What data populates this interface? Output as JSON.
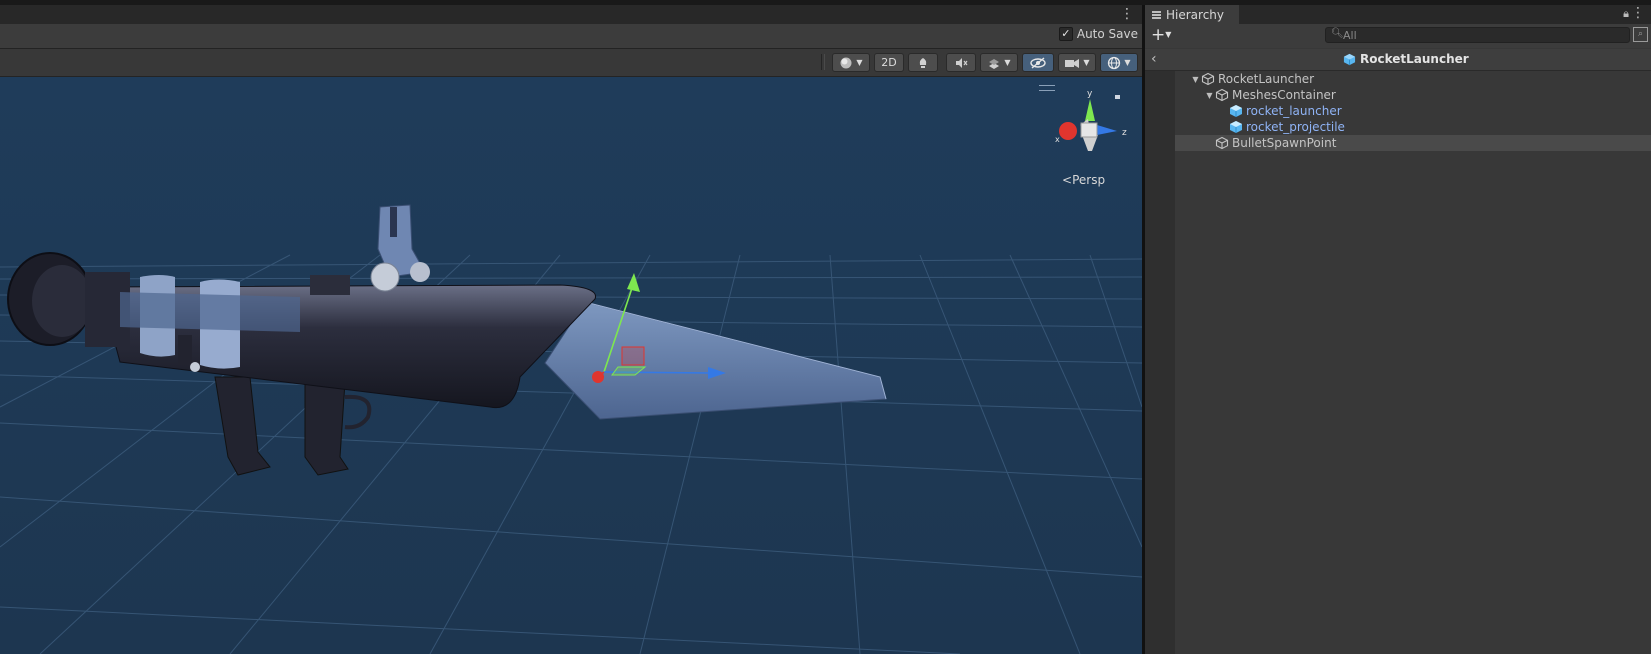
{
  "scene": {
    "auto_save_label": "Auto Save",
    "auto_save_checked": true,
    "toolbar": {
      "shading_mode": "shaded-sphere-icon",
      "mode_2d_label": "2D",
      "lighting": "lighting-icon",
      "audio": "audio-mute-icon",
      "effects": "effects-icon",
      "visibility": "scene-visibility-icon",
      "camera": "camera-icon",
      "gizmos": "gizmos-icon"
    },
    "projection_label": "Persp",
    "gizmo_axes": {
      "x": "x",
      "y": "y",
      "z": "z"
    }
  },
  "hierarchy": {
    "tab_label": "Hierarchy",
    "search_placeholder": "All",
    "breadcrumb": "RocketLauncher",
    "items": [
      {
        "label": "RocketLauncher",
        "kind": "gameobject",
        "expanded": true
      },
      {
        "label": "MeshesContainer",
        "kind": "gameobject",
        "expanded": true
      },
      {
        "label": "rocket_launcher",
        "kind": "prefab"
      },
      {
        "label": "rocket_projectile",
        "kind": "prefab"
      },
      {
        "label": "BulletSpawnPoint",
        "kind": "gameobject",
        "selected": true
      }
    ]
  },
  "colors": {
    "viewport_bg": "#1f3a55",
    "panel_bg": "#383838",
    "prefab_text": "#8fb3f5",
    "axis_x": "#e0352e",
    "axis_y": "#7ee84f",
    "axis_z": "#3479e6"
  }
}
